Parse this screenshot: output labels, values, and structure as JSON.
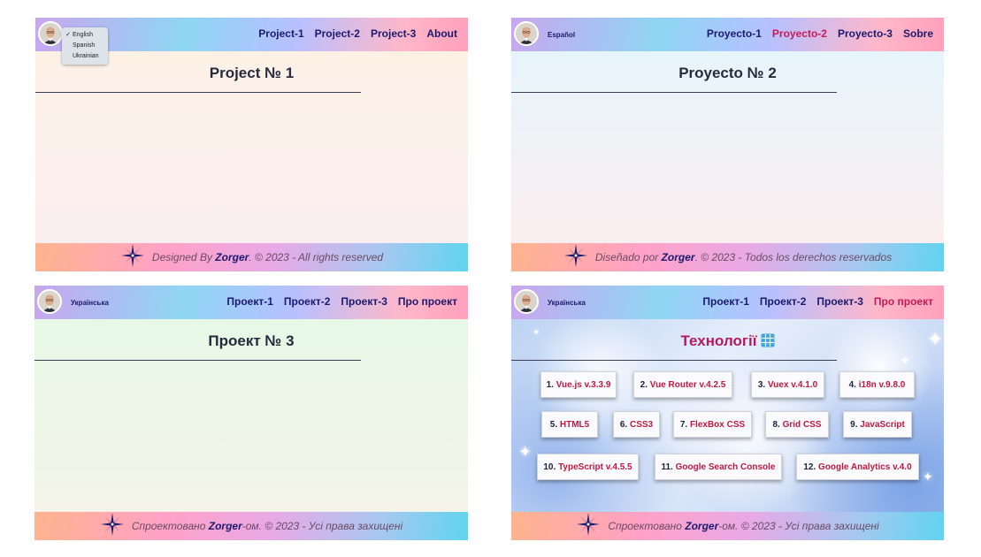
{
  "panels": {
    "p1": {
      "language": "English",
      "nav": [
        "Project-1",
        "Project-2",
        "Project-3",
        "About"
      ],
      "title": "Project № 1",
      "footer": {
        "before": "Designed By ",
        "name": "Zorger",
        "after": ". © 2023 - All rights reserved"
      },
      "bg_color": "#fdf1e6"
    },
    "p2": {
      "language": "Español",
      "nav": [
        "Proyecto-1",
        "Proyecto-2",
        "Proyecto-3",
        "Sobre"
      ],
      "title": "Proyecto № 2",
      "footer": {
        "before": "Diseñado por ",
        "name": "Zorger",
        "after": ". © 2023 - Todos los derechos reservados"
      },
      "bg_color": "#e6f5fb"
    },
    "p3": {
      "language": "Українська",
      "nav": [
        "Проект-1",
        "Проект-2",
        "Проект-3",
        "Про проект"
      ],
      "title": "Проект № 3",
      "footer": {
        "before": "Спроектовано ",
        "name": "Zorger",
        "after": "-ом. © 2023 - Усі права захищені"
      },
      "bg_color": "#e7f8e6"
    },
    "p4": {
      "language": "Українська",
      "nav": [
        "Проект-1",
        "Проект-2",
        "Проект-3",
        "Про проект"
      ],
      "title": "Технології",
      "footer": {
        "before": "Спроектовано ",
        "name": "Zorger",
        "after": "-ом. © 2023 - Усі права захищені"
      },
      "technologies": [
        {
          "num": "1.",
          "name": "Vue.js v.3.3.9"
        },
        {
          "num": "2.",
          "name": "Vue Router v.4.2.5"
        },
        {
          "num": "3.",
          "name": "Vuex v.4.1.0"
        },
        {
          "num": "4.",
          "name": "i18n v.9.8.0"
        },
        {
          "num": "5.",
          "name": "HTML5"
        },
        {
          "num": "6.",
          "name": "CSS3"
        },
        {
          "num": "7.",
          "name": "FlexBox CSS"
        },
        {
          "num": "8.",
          "name": "Grid CSS"
        },
        {
          "num": "9.",
          "name": "JavaScript"
        },
        {
          "num": "10.",
          "name": "TypeScript v.4.5.5"
        },
        {
          "num": "11.",
          "name": "Google Search Console"
        },
        {
          "num": "12.",
          "name": "Google Analytics v.4.0"
        }
      ]
    }
  },
  "language_menu": {
    "selected": "English",
    "options": [
      "English",
      "Spanish",
      "Ukrainian"
    ]
  },
  "colors": {
    "nav_text": "#1b1a6d",
    "nav_active": "#c41c56",
    "tech_name": "#c11740"
  }
}
